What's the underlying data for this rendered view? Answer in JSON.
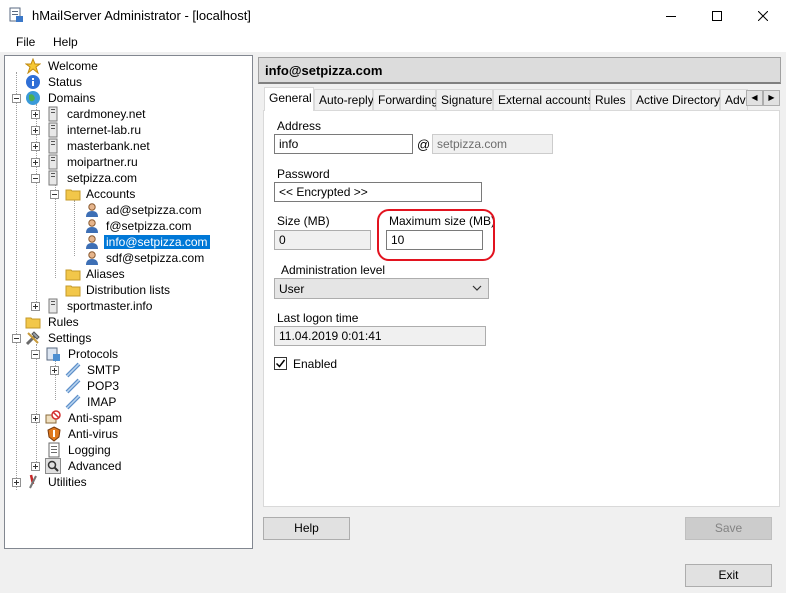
{
  "window": {
    "title": "hMailServer Administrator - [localhost]"
  },
  "menu": {
    "file": "File",
    "help": "Help"
  },
  "tree": {
    "welcome": "Welcome",
    "status": "Status",
    "domains": "Domains",
    "domain_cardmoney": "cardmoney.net",
    "domain_internetlab": "internet-lab.ru",
    "domain_masterbank": "masterbank.net",
    "domain_moipartner": "moipartner.ru",
    "domain_setpizza": "setpizza.com",
    "accounts": "Accounts",
    "account_ad": "ad@setpizza.com",
    "account_f": "f@setpizza.com",
    "account_info": "info@setpizza.com",
    "account_sdf": "sdf@setpizza.com",
    "aliases": "Aliases",
    "distribution_lists": "Distribution lists",
    "domain_sportmaster": "sportmaster.info",
    "rules": "Rules",
    "settings": "Settings",
    "protocols": "Protocols",
    "smtp": "SMTP",
    "pop3": "POP3",
    "imap": "IMAP",
    "antispam": "Anti-spam",
    "antivirus": "Anti-virus",
    "logging": "Logging",
    "advanced": "Advanced",
    "utilities": "Utilities"
  },
  "header": {
    "title": "info@setpizza.com"
  },
  "tabs": {
    "general": "General",
    "autoreply": "Auto-reply",
    "forwarding": "Forwarding",
    "signature": "Signature",
    "external": "External accounts",
    "rules": "Rules",
    "activedirectory": "Active Directory",
    "advanced": "Adva"
  },
  "form": {
    "address_label": "Address",
    "address_value": "info",
    "at_sign": "@",
    "domain_value": "setpizza.com",
    "password_label": "Password",
    "password_value": "<< Encrypted >>",
    "size_label": "Size (MB)",
    "size_value": "0",
    "maxsize_label": "Maximum size (MB)",
    "maxsize_value": "10",
    "adminlevel_label": "Administration level",
    "adminlevel_value": "User",
    "lastlogon_label": "Last logon time",
    "lastlogon_value": "11.04.2019 0:01:41",
    "enabled_label": "Enabled",
    "enabled_checked": true
  },
  "buttons": {
    "help": "Help",
    "save": "Save",
    "exit": "Exit"
  },
  "colors": {
    "selection": "#0078d7",
    "highlight_circle": "#e2131f"
  }
}
